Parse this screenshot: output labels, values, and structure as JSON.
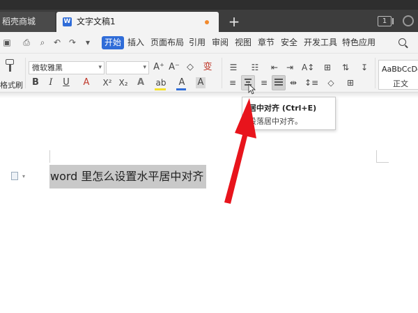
{
  "tabs": {
    "store_tab": "稻壳商城",
    "doc_tab": "文字文稿1",
    "doc_icon_letter": "W",
    "new_tab": "+",
    "window_count": "1"
  },
  "menu": {
    "active": "开始",
    "items": [
      "插入",
      "页面布局",
      "引用",
      "审阅",
      "视图",
      "章节",
      "安全",
      "开发工具",
      "特色应用"
    ],
    "search_label": "Q"
  },
  "ribbon": {
    "format_painter_label": "格式刷",
    "font_name": "微软雅黑",
    "font_size": "",
    "bold": "B",
    "italic": "I",
    "underline": "U",
    "font_color_a": "A",
    "superscript": "X²",
    "subscript": "X₂",
    "text_effect": "A",
    "highlight": "ab",
    "font_color": "A",
    "char_shading": "A",
    "grow_font": "A⁺",
    "shrink_font": "A⁻",
    "clear_format": "◇",
    "phonetic": "变",
    "style_sample": "AaBbCcDc",
    "style_name": "正文"
  },
  "tooltip": {
    "title": "居中对齐 (Ctrl+E)",
    "description": "段落居中对齐。"
  },
  "document": {
    "selected_text": "word 里怎么设置水平居中对齐"
  },
  "colors": {
    "accent": "#2f6cd8",
    "arrow": "#e8141c",
    "tab_bar": "#3d3d3d",
    "ribbon": "#f3f3f3",
    "selection": "#c9c9c9"
  }
}
